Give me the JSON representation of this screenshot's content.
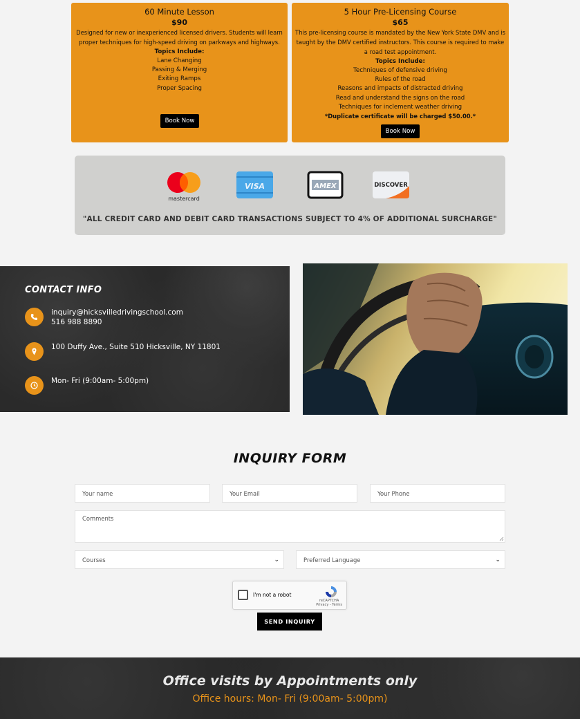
{
  "courses": [
    {
      "title": "60 Minute Lesson",
      "price": "$90",
      "description": "Designed for new or inexperienced licensed drivers. Students will learn proper techniques for high-speed driving on parkways and highways.",
      "topics_heading": "Topics Include:",
      "topics": [
        "Lane Changing",
        "Passing & Merging",
        "Exiting Ramps",
        "Proper Spacing"
      ],
      "note": "",
      "button": "Book Now"
    },
    {
      "title": "5 Hour Pre-Licensing Course",
      "price": "$65",
      "description": "This pre-licensing course is mandated by the New York State DMV and is taught by the DMV certified instructors. This course is required to make a road test appointment.",
      "topics_heading": "Topics Include:",
      "topics": [
        "Techniques of defensive driving",
        "Rules of the road",
        "Reasons and impacts of distracted driving",
        "Read and understand the signs on the road",
        "Techniques for inclement weather driving"
      ],
      "note": "*Duplicate certificate will be charged $50.00.*",
      "button": "Book Now"
    }
  ],
  "payment": {
    "cards": [
      {
        "name": "mastercard",
        "label": "mastercard",
        "icon": "mastercard-icon"
      },
      {
        "name": "visa",
        "label": "VISA",
        "icon": "visa-icon"
      },
      {
        "name": "amex",
        "label": "AMEX",
        "icon": "amex-icon"
      },
      {
        "name": "discover",
        "label": "DISCOVER",
        "icon": "discover-icon"
      }
    ],
    "surcharge": "\"ALL CREDIT CARD AND DEBIT CARD TRANSACTIONS SUBJECT TO 4% OF ADDITIONAL SURCHARGE\""
  },
  "contact": {
    "title": "CONTACT INFO",
    "email": "inquiry@hicksvilledrivingschool.com",
    "phone": "516 988 8890",
    "address": "100 Duffy Ave., Suite 510 Hicksville, NY 11801",
    "hours": "Mon- Fri (9:00am- 5:00pm)",
    "colors": {
      "accent": "#e8931a"
    }
  },
  "form": {
    "title": "INQUIRY FORM",
    "name_placeholder": "Your name",
    "email_placeholder": "Your Email",
    "phone_placeholder": "Your Phone",
    "comments_placeholder": "Comments",
    "courses_selected": "Courses",
    "language_selected": "Preferred Language",
    "captcha_label": "I'm not a robot",
    "captcha_brand": "reCAPTCHA",
    "captcha_links": "Privacy - Terms",
    "submit": "SEND INQUIRY"
  },
  "footer": {
    "line1": "Office visits by Appointments only",
    "line2": "Office hours: Mon- Fri (9:00am- 5:00pm)"
  }
}
